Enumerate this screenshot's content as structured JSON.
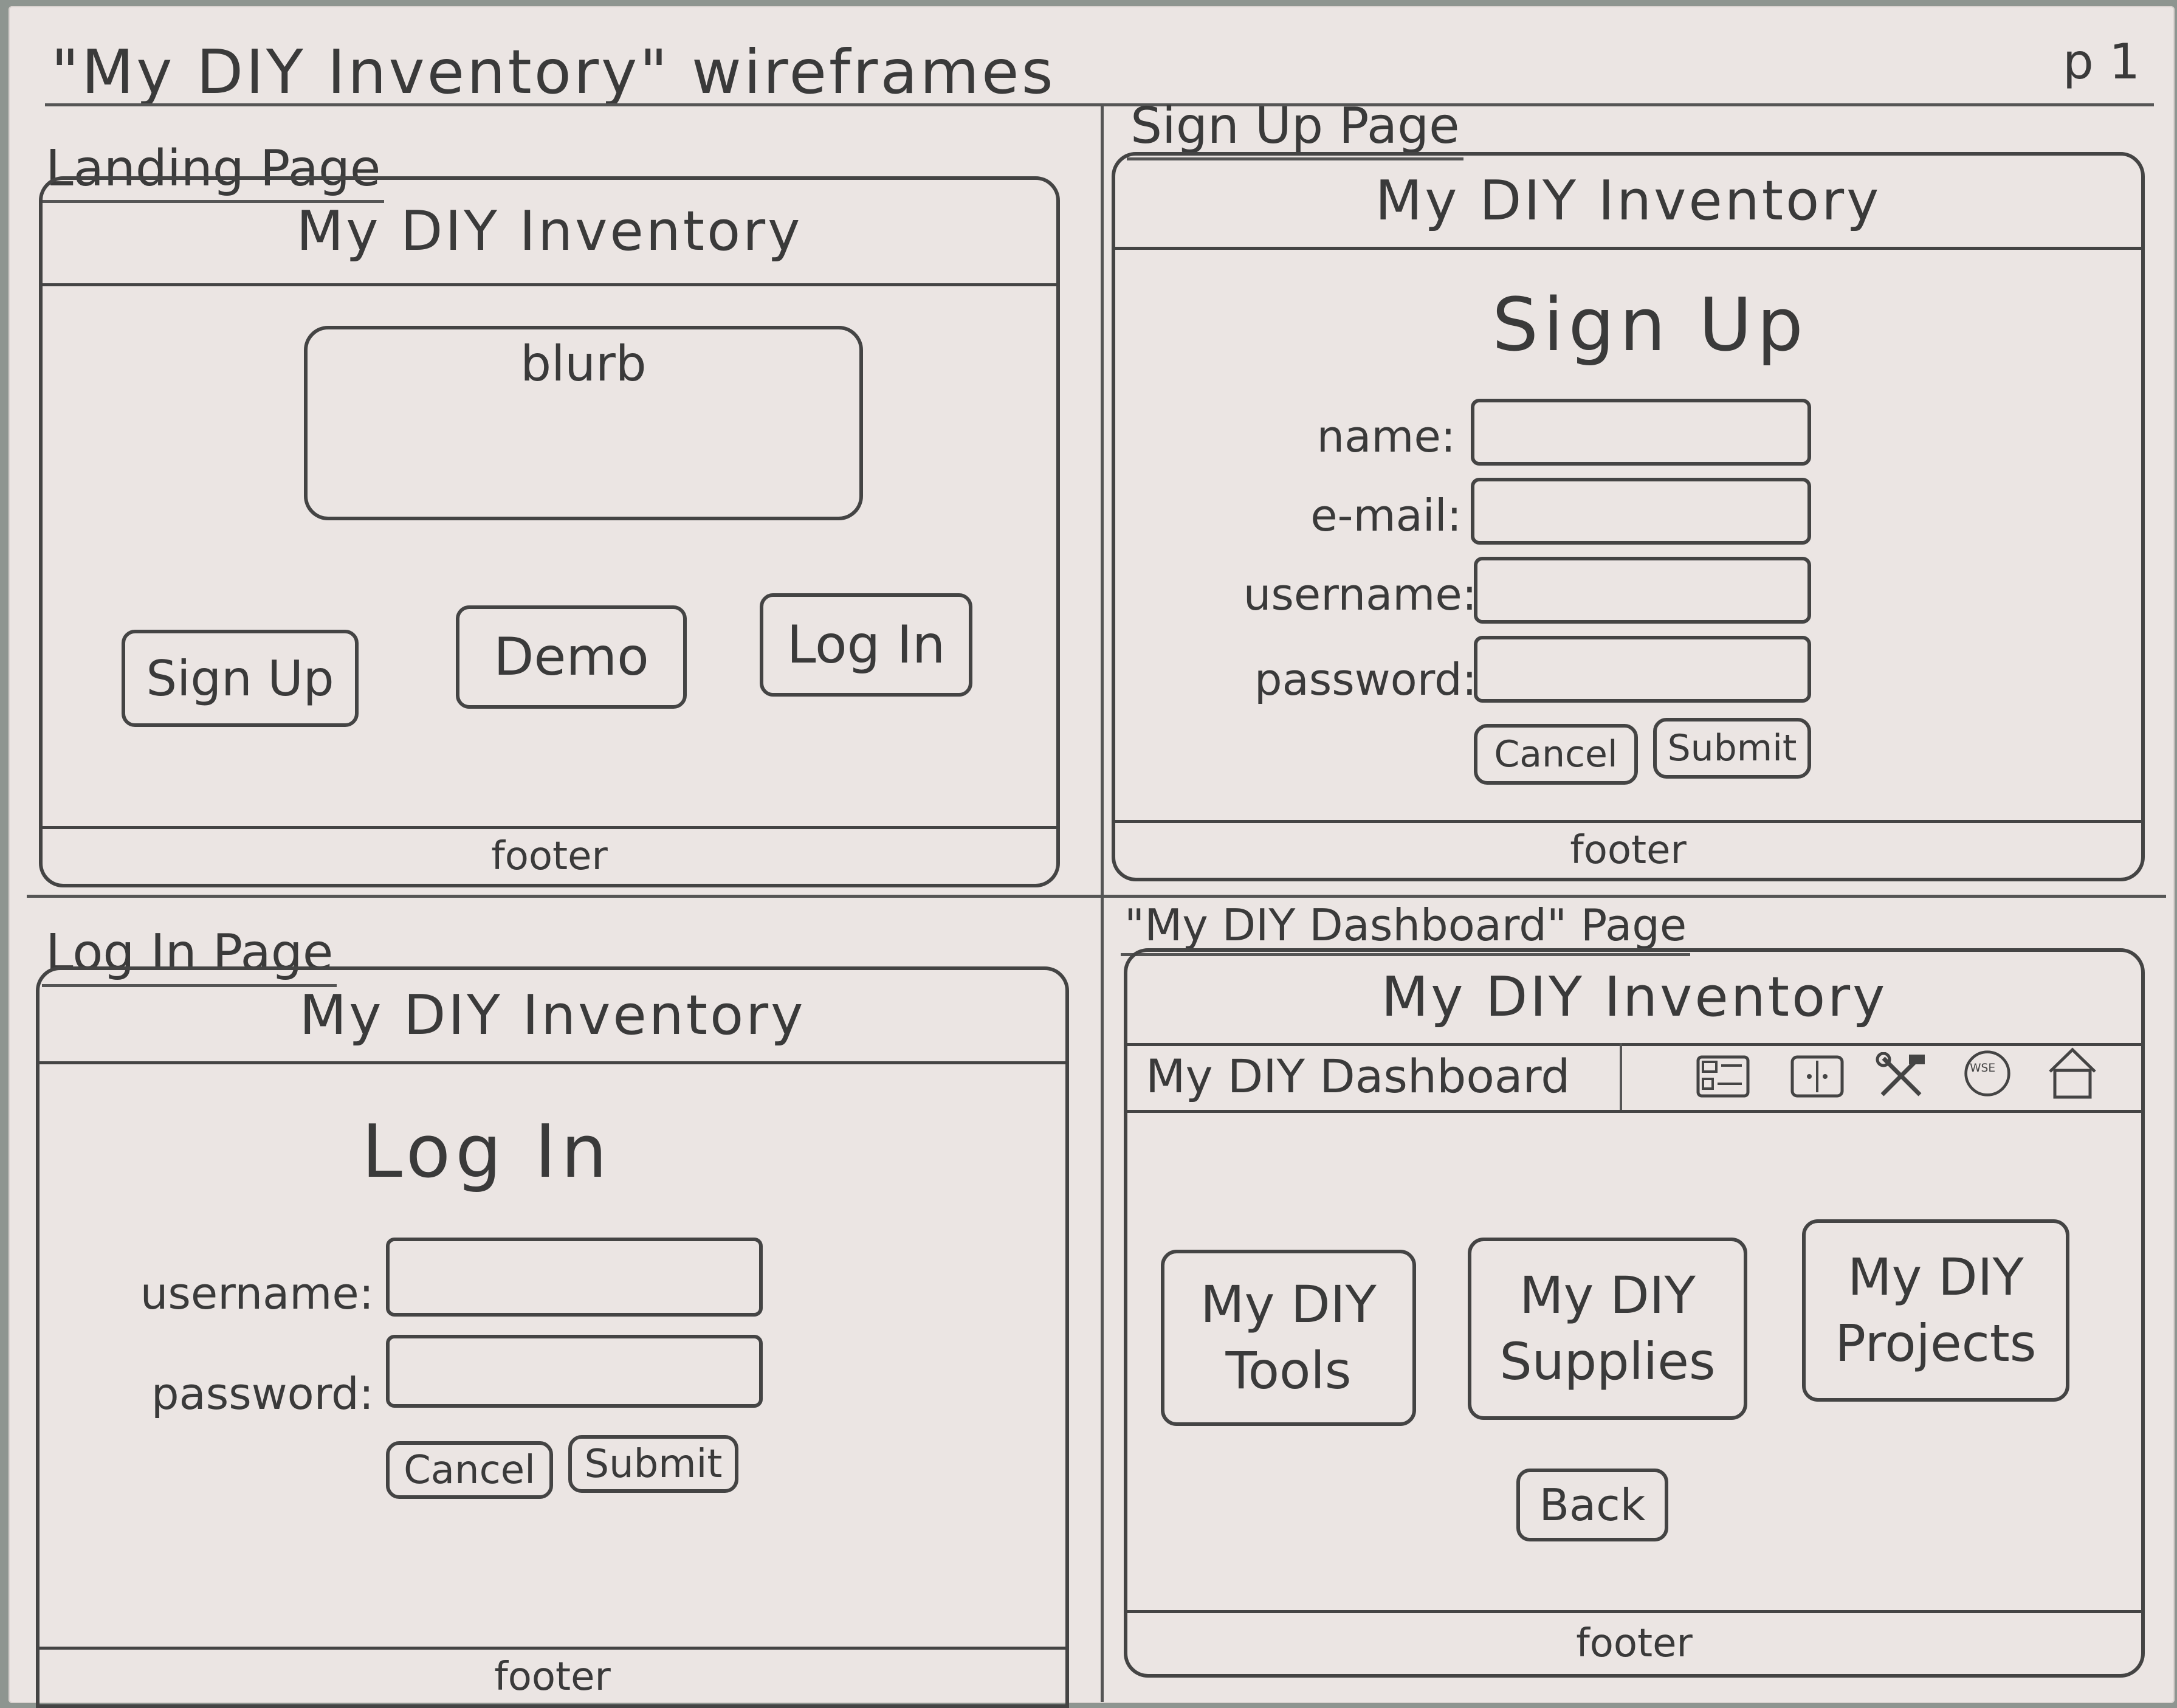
{
  "sheet": {
    "title": "\"My DIY Inventory\" wireframes",
    "page_number": "p 1"
  },
  "landing": {
    "label": "Landing Page",
    "app_title": "My DIY Inventory",
    "blurb": "blurb",
    "signup_label": "Sign Up",
    "demo_label": "Demo",
    "login_label": "Log In",
    "footer": "footer"
  },
  "signup": {
    "label": "Sign Up Page",
    "app_title": "My DIY Inventory",
    "form_title": "Sign Up",
    "name_label": "name:",
    "email_label": "e-mail:",
    "username_label": "username:",
    "password_label": "password:",
    "cancel_label": "Cancel",
    "submit_label": "Submit",
    "footer": "footer"
  },
  "login": {
    "label": "Log In Page",
    "app_title": "My DIY Inventory",
    "form_title": "Log In",
    "username_label": "username:",
    "password_label": "password:",
    "cancel_label": "Cancel",
    "submit_label": "Submit",
    "footer": "footer"
  },
  "dashboard": {
    "label": "\"My DIY Dashboard\" Page",
    "app_title": "My DIY Inventory",
    "nav_title": "My DIY Dashboard",
    "nav_icons": [
      "dashboard-icon",
      "toolbox-icon",
      "tools-icon",
      "compass-icon",
      "home-icon"
    ],
    "compass_letters": "WSE",
    "tools_card": "My DIY Tools",
    "supplies_card": "My DIY Supplies",
    "projects_card": "My DIY Projects",
    "back_label": "Back",
    "footer": "footer"
  }
}
